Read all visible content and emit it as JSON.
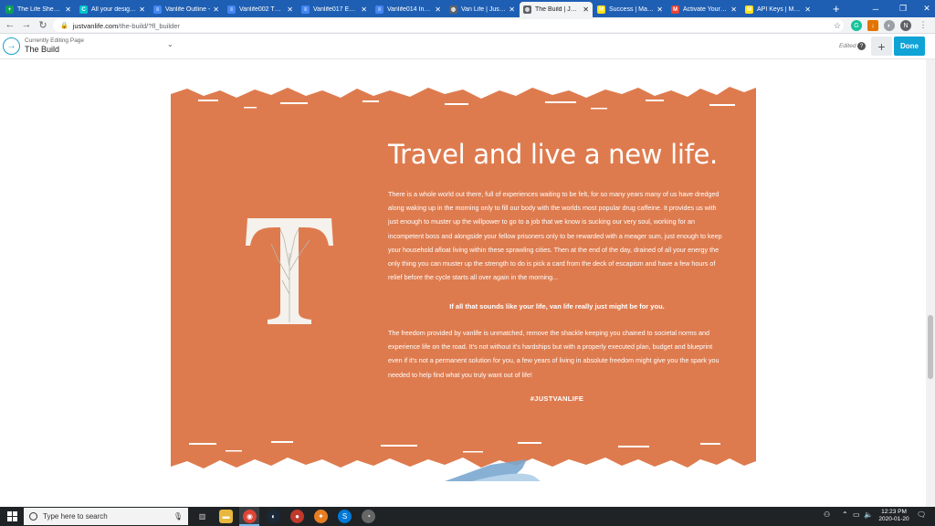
{
  "browser": {
    "tabs": [
      {
        "label": "The Life Sheet - G",
        "icon": "sheets-icon",
        "color": "#0f9d58",
        "glyph": "+"
      },
      {
        "label": "All your designs",
        "icon": "canva-icon",
        "color": "#00c4cc",
        "glyph": "C"
      },
      {
        "label": "Vanlife Outline -",
        "icon": "docs-icon",
        "color": "#4285f4",
        "glyph": "≡"
      },
      {
        "label": "Vanlife002 The B",
        "icon": "docs-icon",
        "color": "#4285f4",
        "glyph": "≡"
      },
      {
        "label": "Vanlife017 Exter",
        "icon": "docs-icon",
        "color": "#4285f4",
        "glyph": "≡"
      },
      {
        "label": "Vanlife014 Insula",
        "icon": "docs-icon",
        "color": "#4285f4",
        "glyph": "≡"
      },
      {
        "label": "Van Life | Just Va",
        "icon": "globe-icon",
        "color": "#5f6368",
        "glyph": "◍"
      },
      {
        "label": "The Build | Just V",
        "icon": "globe-icon",
        "color": "#5f6368",
        "glyph": "◍"
      },
      {
        "label": "Success | Mailch",
        "icon": "mailchimp-icon",
        "color": "#ffe01b",
        "glyph": "M"
      },
      {
        "label": "Activate Your Ma",
        "icon": "gmail-icon",
        "color": "#ea4335",
        "glyph": "M"
      },
      {
        "label": "API Keys | Mailch",
        "icon": "mailchimp-icon",
        "color": "#ffe01b",
        "glyph": "M"
      }
    ],
    "active_tab_index": 7,
    "new_tab": "+",
    "url_host": "justvanlife.com",
    "url_path": "/the-build/?fl_builder"
  },
  "builder": {
    "subtitle": "Currently Editing Page",
    "title": "The Build",
    "edited_label": "Edited",
    "help": "?",
    "add": "+",
    "done_label": "Done"
  },
  "hero": {
    "accent": "#de7b4e",
    "drop_cap": "T",
    "headline": "Travel and live a new life.",
    "paragraph1": "There is a whole world out there, full of experiences waiting to be felt, for so many years many of us have dredged along waking up in the morning only to fill our body with the worlds most popular drug caffeine. It provides us with just enough to muster up the willpower to go to a job that we know is sucking our very soul, working for an incompetent boss and alongside your fellow prisoners only to be rewarded with a meager sum, just enough to keep your household afloat living within these sprawling cities. Then at the end of the day, drained of all your energy the only thing you can muster up the strength to do is pick a card from the deck of escapism and have a few hours of relief before the cycle starts all over again in the morning...",
    "callout": "If all that sounds like your life, van life really just might be for you.",
    "paragraph2": "The freedom provided by vanlife is unmatched, remove the shackle keeping you chained to societal norms and experience life on the road. It's not without it's hardships but with a properly executed plan, budget and blueprint even if it's not a permanent solution for you, a few years of living in absolute freedom might give you the spark you needed to help find what you truly want out of life!",
    "hashtag": "#JUSTVANLIFE"
  },
  "taskbar": {
    "search_placeholder": "Type here to search",
    "time": "12:23 PM",
    "date": "2020-01-20"
  }
}
